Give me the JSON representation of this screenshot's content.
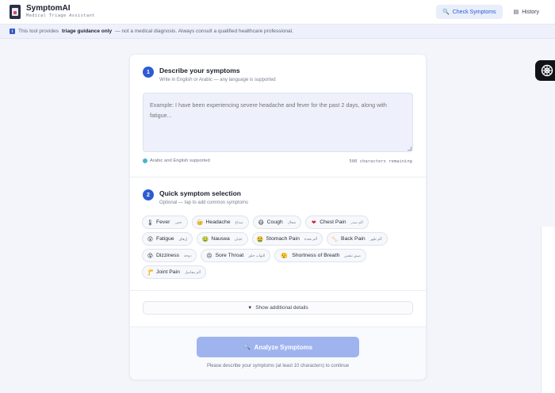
{
  "header": {
    "brand_name": "SymptomAI",
    "brand_sub": "Medical Triage Assistant",
    "nav": [
      {
        "label": "Check Symptoms",
        "icon": "search-icon",
        "active": true
      },
      {
        "label": "History",
        "icon": "document-icon",
        "active": false
      }
    ]
  },
  "notice": {
    "prefix": "This tool provides",
    "bold": "triage guidance only",
    "suffix": "— not a medical diagnosis. Always consult a qualified healthcare professional."
  },
  "step1": {
    "number": "1",
    "title": "Describe your symptoms",
    "subtitle": "Write in English or Arabic — any language is supported",
    "placeholder": "Example: I have been experiencing severe headache and fever for the past 2 days, along with fatigue...",
    "lang_note": "Arabic and English supported",
    "chars_remaining": "500 characters remaining"
  },
  "step2": {
    "number": "2",
    "title": "Quick symptom selection",
    "subtitle": "Optional — tap to add common symptoms",
    "chips": [
      [
        {
          "emoji": "🌡",
          "label": "Fever",
          "ar": "حمى"
        },
        {
          "emoji": "🤕",
          "label": "Headache",
          "ar": "صداع"
        },
        {
          "emoji": "😷",
          "label": "Cough",
          "ar": "سعال"
        },
        {
          "emoji": "❤",
          "label": "Chest Pain",
          "ar": "ألم صدر"
        }
      ],
      [
        {
          "emoji": "😮",
          "label": "Fatigue",
          "ar": "إرهاق"
        },
        {
          "emoji": "🤢",
          "label": "Nausea",
          "ar": "غثيان"
        },
        {
          "emoji": "🤮",
          "label": "Stomach Pain",
          "ar": "ألم معدة"
        },
        {
          "emoji": "🦴",
          "label": "Back Pain",
          "ar": "ألم ظهر"
        }
      ],
      [
        {
          "emoji": "😵",
          "label": "Dizziness",
          "ar": "دوخة"
        },
        {
          "emoji": "😣",
          "label": "Sore Throat",
          "ar": "التهاب حلق"
        },
        {
          "emoji": "😮‍💨",
          "label": "Shortness of Breath",
          "ar": "ضيق تنفس"
        }
      ],
      [
        {
          "emoji": "🦵",
          "label": "Joint Pain",
          "ar": "ألم مفاصل"
        }
      ]
    ]
  },
  "details_toggle": "Show additional details",
  "analyze": {
    "label": "Analyze Symptoms",
    "hint": "Please describe your symptoms (at least 10 characters) to continue"
  },
  "colors": {
    "accent": "#2d5bd3",
    "button_disabled": "#9fb3ef",
    "notice_bg": "#eef0fb"
  }
}
